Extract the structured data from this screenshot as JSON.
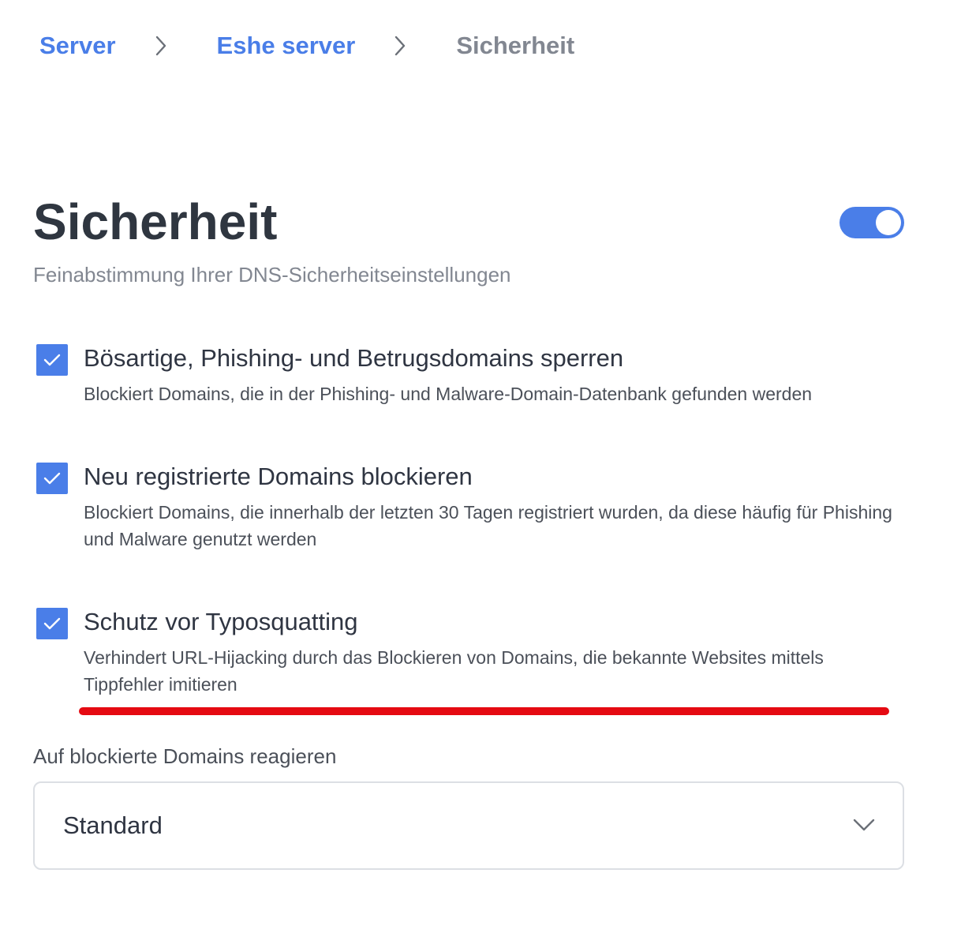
{
  "breadcrumb": {
    "items": [
      {
        "label": "Server"
      },
      {
        "label": "Eshe server"
      },
      {
        "label": "Sicherheit"
      }
    ]
  },
  "header": {
    "title": "Sicherheit",
    "subtitle": "Feinabstimmung Ihrer DNS-Sicherheitseinstellungen",
    "toggle_enabled": true
  },
  "options": [
    {
      "title": "Bösartige, Phishing- und Betrugsdomains sperren",
      "description": "Blockiert Domains, die in der Phishing- und Malware-Domain-Datenbank gefunden werden",
      "checked": true
    },
    {
      "title": "Neu registrierte Domains blockieren",
      "description": "Blockiert Domains, die innerhalb der letzten 30 Tagen registriert wurden, da diese häufig für Phishing und Malware genutzt werden",
      "checked": true
    },
    {
      "title": "Schutz vor Typosquatting",
      "description": "Verhindert URL-Hijacking durch das Blockieren von Domains, die bekannte Websites mittels Tippfehler imitieren",
      "checked": true
    }
  ],
  "blocked_response": {
    "label": "Auf blockierte Domains reagieren",
    "selected": "Standard"
  },
  "colors": {
    "accent": "#4a7ee8",
    "annotation": "#e50a12",
    "muted_text": "#828791"
  }
}
